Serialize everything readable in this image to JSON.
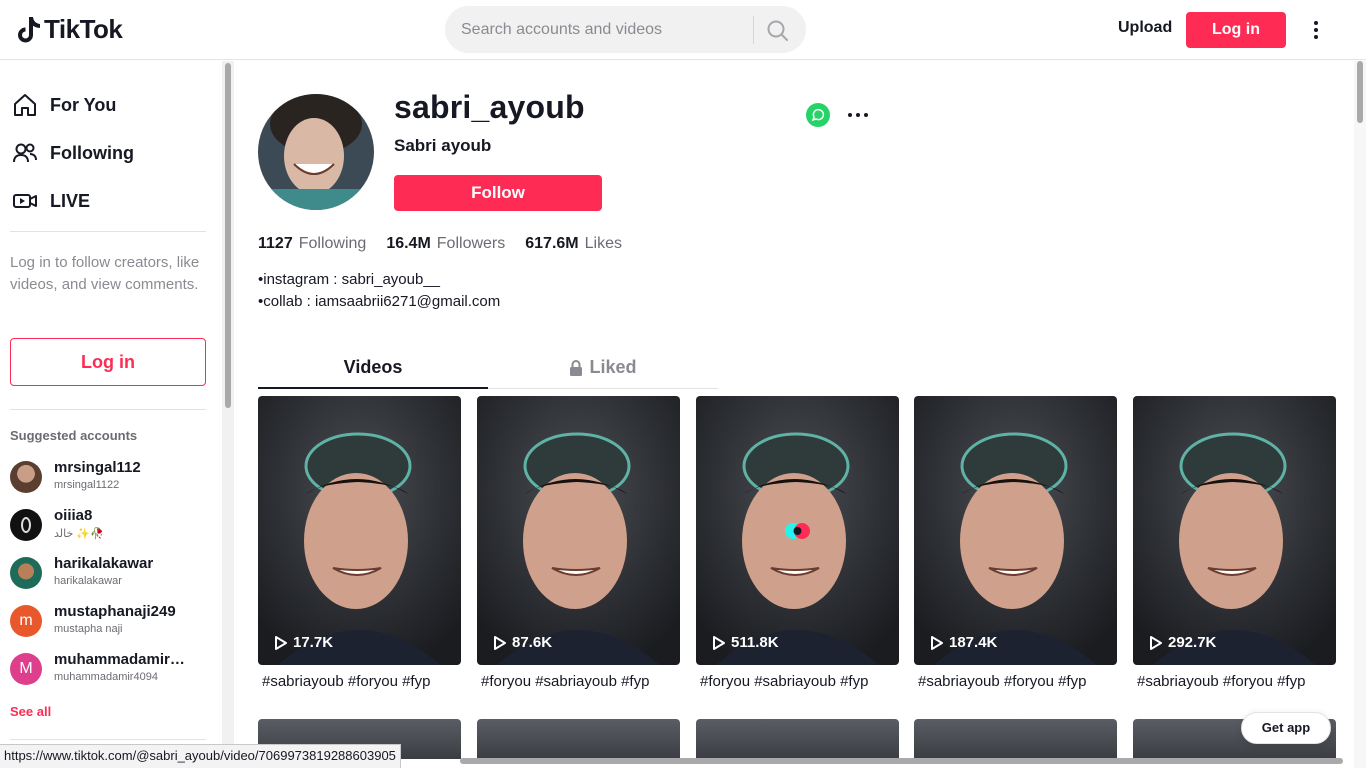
{
  "header": {
    "logo_text": "TikTok",
    "search_placeholder": "Search accounts and videos",
    "upload_label": "Upload",
    "login_label": "Log in"
  },
  "sidebar": {
    "nav": [
      {
        "label": "For You",
        "icon": "home-icon"
      },
      {
        "label": "Following",
        "icon": "people-icon"
      },
      {
        "label": "LIVE",
        "icon": "live-icon"
      }
    ],
    "login_hint": "Log in to follow creators, like videos, and view comments.",
    "login_button": "Log in",
    "suggested_title": "Suggested accounts",
    "accounts": [
      {
        "username": "mrsingal112",
        "name": "mrsingal1122",
        "avatar_color": "#7a5a4a"
      },
      {
        "username": "oiiia8",
        "name": "خالد ✨🥀",
        "avatar_color": "#111111"
      },
      {
        "username": "harikalakawar",
        "name": "harikalakawar",
        "avatar_color": "#1f6b5a"
      },
      {
        "username": "mustaphanaji249",
        "name": "mustapha naji",
        "avatar_color": "#e8582b",
        "initial": "m"
      },
      {
        "username": "muhammadamir…",
        "name": "muhammadamir4094",
        "avatar_color": "#de3f8c",
        "initial": "M"
      }
    ],
    "see_all": "See all"
  },
  "profile": {
    "username": "sabri_ayoub",
    "display_name": "Sabri ayoub",
    "follow_label": "Follow",
    "stats": [
      {
        "number": "1127",
        "label": "Following"
      },
      {
        "number": "16.4M",
        "label": "Followers"
      },
      {
        "number": "617.6M",
        "label": "Likes"
      }
    ],
    "bio": "•instagram : sabri_ayoub__\n•collab : iamsaabrii6271@gmail.com"
  },
  "tabs": {
    "videos": "Videos",
    "liked": "Liked"
  },
  "videos": [
    {
      "views": "17.7K",
      "caption": "#sabriayoub #foryou #fyp"
    },
    {
      "views": "87.6K",
      "caption": "#foryou #sabriayoub #fyp"
    },
    {
      "views": "511.8K",
      "caption": "#foryou #sabriayoub #fyp"
    },
    {
      "views": "187.4K",
      "caption": "#sabriayoub #foryou #fyp"
    },
    {
      "views": "292.7K",
      "caption": "#sabriayoub #foryou #fyp"
    }
  ],
  "get_app": "Get app",
  "status_url": "https://www.tiktok.com/@sabri_ayoub/video/7069973819288603905",
  "colors": {
    "accent": "#fe2c55",
    "text": "#161823",
    "muted": "#8a8b91"
  }
}
